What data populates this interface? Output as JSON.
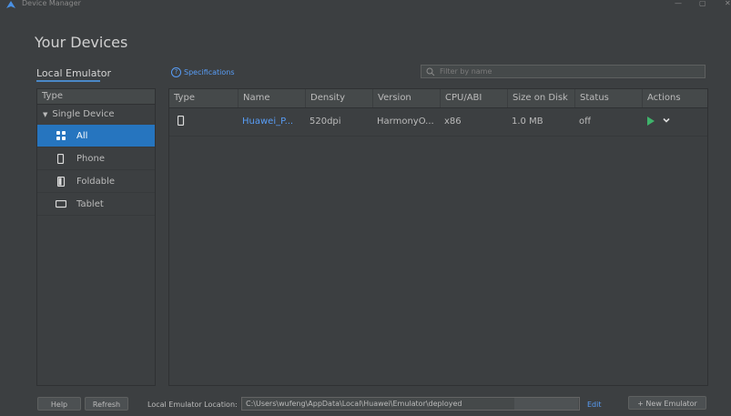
{
  "window": {
    "title": "Device Manager",
    "minimize_label": "—",
    "maximize_label": "▢",
    "close_label": "✕"
  },
  "page_title": "Your Devices",
  "tabs": {
    "local": "Local Emulator"
  },
  "specifications_link": "Specifications",
  "filter": {
    "placeholder": "Filter by name",
    "value": ""
  },
  "sidebar": {
    "header": "Type",
    "group": "Single Device",
    "items": [
      {
        "label": "All",
        "icon": "grid-icon",
        "selected": true
      },
      {
        "label": "Phone",
        "icon": "phone-icon",
        "selected": false
      },
      {
        "label": "Foldable",
        "icon": "foldable-icon",
        "selected": false
      },
      {
        "label": "Tablet",
        "icon": "tablet-icon",
        "selected": false
      }
    ]
  },
  "table": {
    "columns": [
      "Type",
      "Name",
      "Density",
      "Version",
      "CPU/ABI",
      "Size on Disk",
      "Status",
      "Actions"
    ],
    "rows": [
      {
        "type_icon": "phone-icon",
        "name": "Huawei_P...",
        "density": "520dpi",
        "version": "HarmonyO...",
        "cpu": "x86",
        "size": "1.0 MB",
        "status": "off"
      }
    ]
  },
  "footer": {
    "help": "Help",
    "refresh": "Refresh",
    "location_label": "Local Emulator Location:",
    "location_value": "C:\\Users\\wufeng\\AppData\\Local\\Huawei\\Emulator\\deployed",
    "edit": "Edit",
    "new_emulator": "+ New Emulator"
  },
  "colors": {
    "accent": "#2675bf",
    "link": "#589df6",
    "play": "#3fb36b",
    "background": "#3c3f41"
  }
}
